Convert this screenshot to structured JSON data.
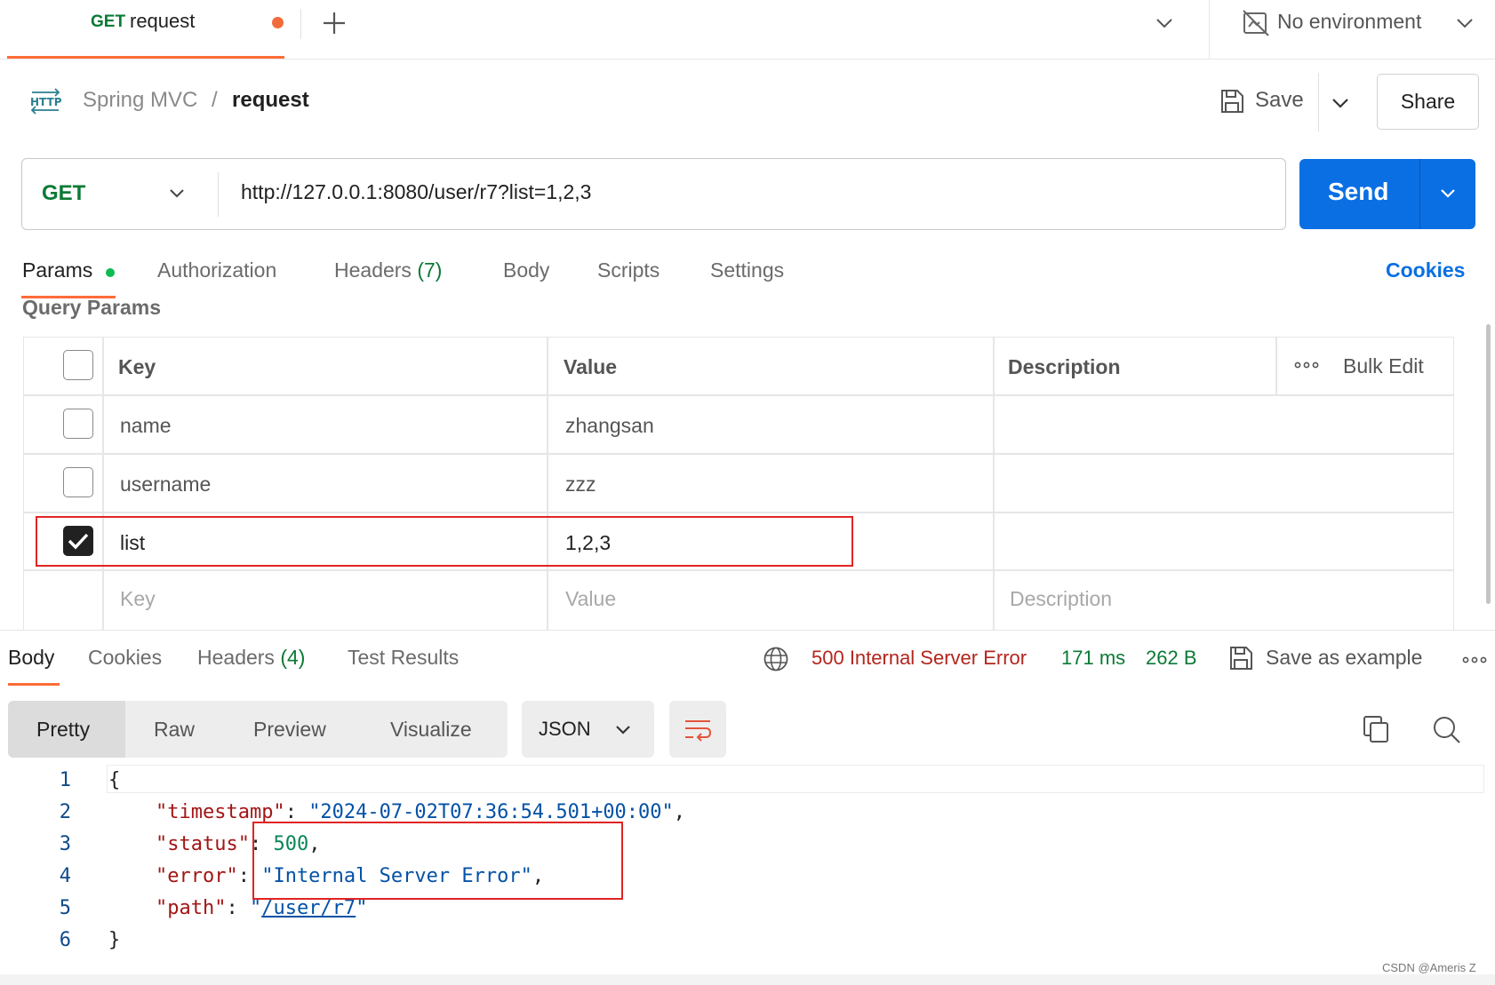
{
  "tab": {
    "method": "GET",
    "name": "request"
  },
  "environment": {
    "label": "No environment"
  },
  "breadcrumb": {
    "parent": "Spring MVC",
    "separator": "/",
    "current": "request"
  },
  "toolbar": {
    "save_label": "Save",
    "share_label": "Share"
  },
  "request": {
    "method": "GET",
    "url": "http://127.0.0.1:8080/user/r7?list=1,2,3",
    "send_label": "Send"
  },
  "request_tabs": {
    "params": "Params",
    "authorization": "Authorization",
    "headers": "Headers",
    "headers_count": "(7)",
    "body": "Body",
    "scripts": "Scripts",
    "settings": "Settings",
    "cookies": "Cookies"
  },
  "query_params": {
    "title": "Query Params",
    "columns": {
      "key": "Key",
      "value": "Value",
      "description": "Description"
    },
    "bulk_edit": "Bulk Edit",
    "rows": [
      {
        "checked": false,
        "key": "name",
        "value": "zhangsan"
      },
      {
        "checked": false,
        "key": "username",
        "value": "zzz"
      },
      {
        "checked": true,
        "key": "list",
        "value": "1,2,3"
      }
    ],
    "placeholder": {
      "key": "Key",
      "value": "Value",
      "description": "Description"
    }
  },
  "response": {
    "tabs": {
      "body": "Body",
      "cookies": "Cookies",
      "headers": "Headers",
      "headers_count": "(4)",
      "test_results": "Test Results"
    },
    "status": "500 Internal Server Error",
    "time": "171 ms",
    "size": "262 B",
    "save_example": "Save as example",
    "views": {
      "pretty": "Pretty",
      "raw": "Raw",
      "preview": "Preview",
      "visualize": "Visualize"
    },
    "format": "JSON",
    "line_numbers": [
      "1",
      "2",
      "3",
      "4",
      "5",
      "6"
    ],
    "json": {
      "open": "{",
      "close": "}",
      "timestamp_key": "\"timestamp\"",
      "timestamp_value": "\"2024-07-02T07:36:54.501+00:00\"",
      "status_key": "\"status\"",
      "status_value": "500",
      "error_key": "\"error\"",
      "error_value": "\"Internal Server Error\"",
      "path_key": "\"path\"",
      "path_value": "/user/r7"
    }
  },
  "watermark": "CSDN @Ameris Z",
  "colors": {
    "accent": "#ff6c37",
    "send": "#0a6fe3",
    "method_get": "#0b7a35",
    "error": "#b3261e",
    "success": "#0b7a35"
  }
}
